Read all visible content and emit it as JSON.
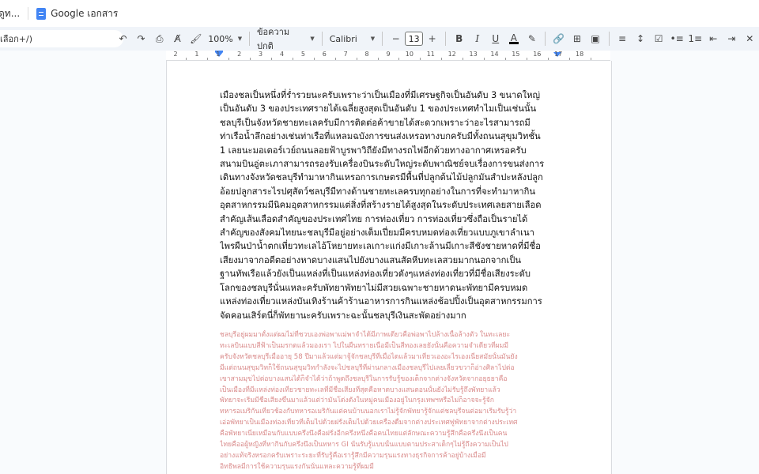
{
  "tabbar": {
    "left_fragment": "ดูท...",
    "doc_title": "Google เอกสาร"
  },
  "toolbar": {
    "menu_search": "เลือก+/)",
    "zoom": "100%",
    "style": "ข้อความปกติ",
    "font": "Calibri",
    "font_size": "13",
    "icons": [
      "undo-icon",
      "redo-icon",
      "print-icon",
      "spellcheck-icon",
      "paint-format-icon",
      "bold-icon",
      "italic-icon",
      "underline-icon",
      "text-color-icon",
      "highlight-icon",
      "link-icon",
      "comment-icon",
      "image-icon",
      "align-icon",
      "line-spacing-icon",
      "checklist-icon",
      "bullet-list-icon",
      "numbered-list-icon",
      "decrease-indent-icon",
      "increase-indent-icon",
      "clear-format-icon"
    ],
    "text_color": "#000000"
  },
  "ruler": {
    "numbers": [
      "2",
      "1",
      "1",
      "2",
      "3",
      "4",
      "5",
      "6",
      "7",
      "8",
      "9",
      "10",
      "11",
      "12",
      "13",
      "14",
      "15",
      "16",
      "17",
      "18"
    ]
  },
  "document": {
    "paragraph_lines": [
      "เมืองชลเป็นหนึ่งที่ร่ำรวยนะครับเพราะว่าเป็นเมืองที่มีเศรษฐกิจเป็นอันดับ 3 ขนาดใหญ่",
      "เป็นอันดับ 3 ของประเทศรายได้เฉลี่ยสูงสุดเป็นอันดับ 1 ของประเทศทำไมเป็นเช่นนั้น",
      "ชลบุรีเป็นจังหวัดชายทะเลครับมีการติดต่อค้าขายได้สะดวกเพราะว่าอะไรสามารถมี",
      "ท่าเรือน้ำลึกอย่างเช่นท่าเรือที่แหลมฉบังการขนส่งเหรอทางบกครับมีทั้งถนนสุขุมวิทชั้น",
      "1 เลยนะมอเตอร์เวย์ถนนลอยฟ้าบูรพาวิถียังมีทางรถไฟอีกด้วยทางอากาศเหรอครับ",
      "สนามบินอู่ตะเภาสามารถรองรับเครื่องบินระดับใหญ่ระดับพาณิชย์จบเรื่องการขนส่งการ",
      "เดินทางจังหวัดชลบุรีทำมาหากินเหรอการเกษตรมีพื้นที่ปลูกต้นไม้ปลูกมันสำปะหลังปลูก",
      "อ้อยปลูกสาระไรปศุสัตว์ชลบุรีมีทางด้านชายทะเลครบทุกอย่างในการที่จะทำมาหากิน",
      "อุตสาหกรรมมีนิคมอุตสาหกรรมแต่สิ่งที่สร้างรายได้สูงสุดในระดับประเทศเลยสายเลือด",
      "สำคัญเส้นเลือดสำคัญของประเทศไทย  การท่องเที่ยว การท่องเที่ยวซึ่งถือเป็นรายได้",
      "สำคัญของสังคมไทยนะชลบุรีมีอยู่อย่างเต็มเปี่ยมมีครบหมดท่องเที่ยวแบบภูเขาลำเนา",
      "ไพรผืนป่าน้ำตกเที่ยวทะเลไอ้โหยายทะเลเกาะแก่งมีเกาะล้านมีเกาะสีชังชายหาดที่มีชื่อ",
      "เสียงมาจากอดีตอย่างหาดบางแสนไปยังบางแสนสัตหีบทะเลสวยมากนอกจากเป็น",
      "ฐานทัพเรือแล้วยังเป็นแหล่งที่เป็นแหล่งท่องเที่ยวดังๆแหล่งท่องเที่ยวที่มีชื่อเสียงระดับ",
      "โลกของชลบุรีนั่นแหละครับพัทยาพัทยาไม่มีสวยเฉพาะชายหาดนะพัทยามีครบหมด",
      "แหล่งท่องเที่ยวแหล่งบันเทิงร้านค้าร้านอาหารการกินแหล่งช้อปปิ้งเป็นอุตสาหกรรมการ",
      "จัดคอนเสิร์ตนี่ก็พัทยานะครับเพราะฉะนั้นชลบุรีเงินสะพัดอย่างมาก"
    ],
    "faded_lines": [
      "ชลบุรีอยู่ผมมาตั้งแต่ผมไม่ที่ชวบเองพ่อพาแม่พาจำได้มีภาพเดียวคือพ่อพาไปล้างเนื้อล้างตัว ในทะเลยะ",
      "ทะเลบินแบบสีฟ้าเป็นมรกตแล้วมองเรา ไปในผืนทรายเนื่อมีเป็นสีทองเลยยังนั้นคือความจำเดียวที่ผมมี",
      "ครับจังหวัดชลบุรีเมื่ออายุ 58 ปีมาแล้วแต่มาจู้จักชลบุรีที่เมื่อไดแล้วมาเที่ยวเองอะไรเองเนี่ยสมัยนั้นมันยัง",
      "มีแต่ถนนสุขุมวิทก็ใช้ถนนสุขุมวิทกำลังจะไปชลบุรีที่ผ่านกลางเมืองชลบุรีไปเลยเลี้ยวขวาก็อ่างศิลาไปต่อ",
      "เขาสามมุขไปต่อบางแสนได้ก็จำได้ว่าถ้าพูดถึงชลบุรีในการรับรู้ของเด็กจากต่างจังหวัดจากอยุธยาคือ",
      "เป็นเมืองที่มีแหล่งท่องเที่ยวชายทะเลที่มีชื่อเสียงที่สุดคือหาดบางแสนตอนนั้นยังไม่รับรู้ถึงพัทยาแล้ว",
      "พัทยาจะเริ่มมีชื่อเสียงขึ้นมาแล้วแต่ว่ามันโด่งดังในหมู่คนเมืองอยู่ในกรุงเทพฯหรือไม่ก็อาจจะรู้จัก",
      "ทหารอเมริกันเที่ยวช้องกับทหารอเมริกันแต่คนบ้านนอกเราไม่รู้จักพัทยารู้จักแต่ชลบุรีจนต่อมาเริ่มรับรู้ว่า",
      "เอ่อพัทยาเป็นเมืองท่องเที่ยวที่เต็มไปด้วยฝรั่งเต็มไปด้วยเครื่องดื่มจากต่างประเทศฟูพัทยาจากต่างประเทศ",
      "คือพัทยาเนี่ยเหมือนกับแบบครึ่งนึงคือฝรั่งอีกครึ่งหนึ่งคือคนไทยแต่ลักษณะความรู้สึกคือครึ่งนึงเป็นคน",
      "ไทยคืออผู้หญิงที่หากินกับครึ่งนึงเป็นทหาร GI นั่นรับรู้แบบนั้นแบบตามประสาเด็กๆไม่รู้ถึงความเป็นไป",
      "อย่างแท้จริงหรอกครับเพราะระยะที่รับรู้คือเรารู้สึกมีความรุนแรงทางธุรกิจการค้าอยู่บ้างเมื่อมี",
      "อิทธิพลมีการใช้ความรุนแรงกันนั่นแหละความรู้ที่ผมมี"
    ]
  }
}
